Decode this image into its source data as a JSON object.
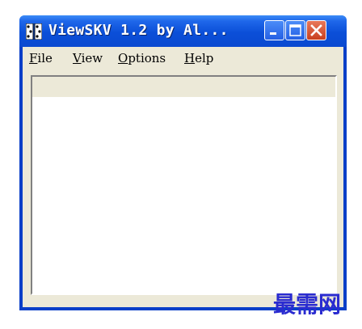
{
  "window": {
    "title": "ViewSKV 1.2 by Al...",
    "title_color": "#ffffff",
    "titlebar_color": "#0b4fd8",
    "icon": "app-dice-icon"
  },
  "titlebar_buttons": {
    "minimize_icon": "minimize-icon",
    "maximize_icon": "maximize-icon",
    "close_icon": "close-icon"
  },
  "menu": {
    "file": {
      "mnemonic": "F",
      "rest": "ile"
    },
    "view": {
      "mnemonic": "V",
      "rest": "iew"
    },
    "options": {
      "mnemonic": "O",
      "rest": "ptions"
    },
    "help": {
      "mnemonic": "H",
      "rest": "elp"
    }
  },
  "watermark": {
    "text": "最需网",
    "color": "#2a2bd0"
  }
}
